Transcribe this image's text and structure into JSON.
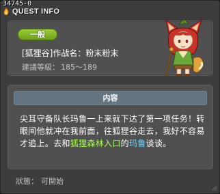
{
  "window": {
    "quest_id": "34745-0",
    "title": "QUEST INFO"
  },
  "quest": {
    "category_badge": "一般",
    "name": "[狐狸谷]作战名：粉末粉末",
    "level_label": "建議等級：",
    "level_range": "185～189"
  },
  "content": {
    "header": "内容",
    "text_part1": "尖耳守备队长玛鲁一上来就下达了第一项任务！转眼间他就冲在我前面，往狐狸谷走去，我好不容易才追上。去和",
    "highlight_place": "狐狸森林入口",
    "text_part2": "的",
    "highlight_npc": "玛鲁",
    "text_part3": "谈谈。"
  },
  "status": {
    "label": "狀態：",
    "value": "可開始"
  },
  "colors": {
    "window_bg": "#3d3d3d",
    "panel_bg": "#505050",
    "badge_green": "#8bbd2c",
    "header_blue": "#647480",
    "highlight_green": "#a8ff4c",
    "highlight_blue": "#6fd6ff"
  },
  "icons": {
    "title": "flame-bullet-icon",
    "npc": "fox-girl-npc-portrait",
    "grip": "resize-grip-icon"
  }
}
